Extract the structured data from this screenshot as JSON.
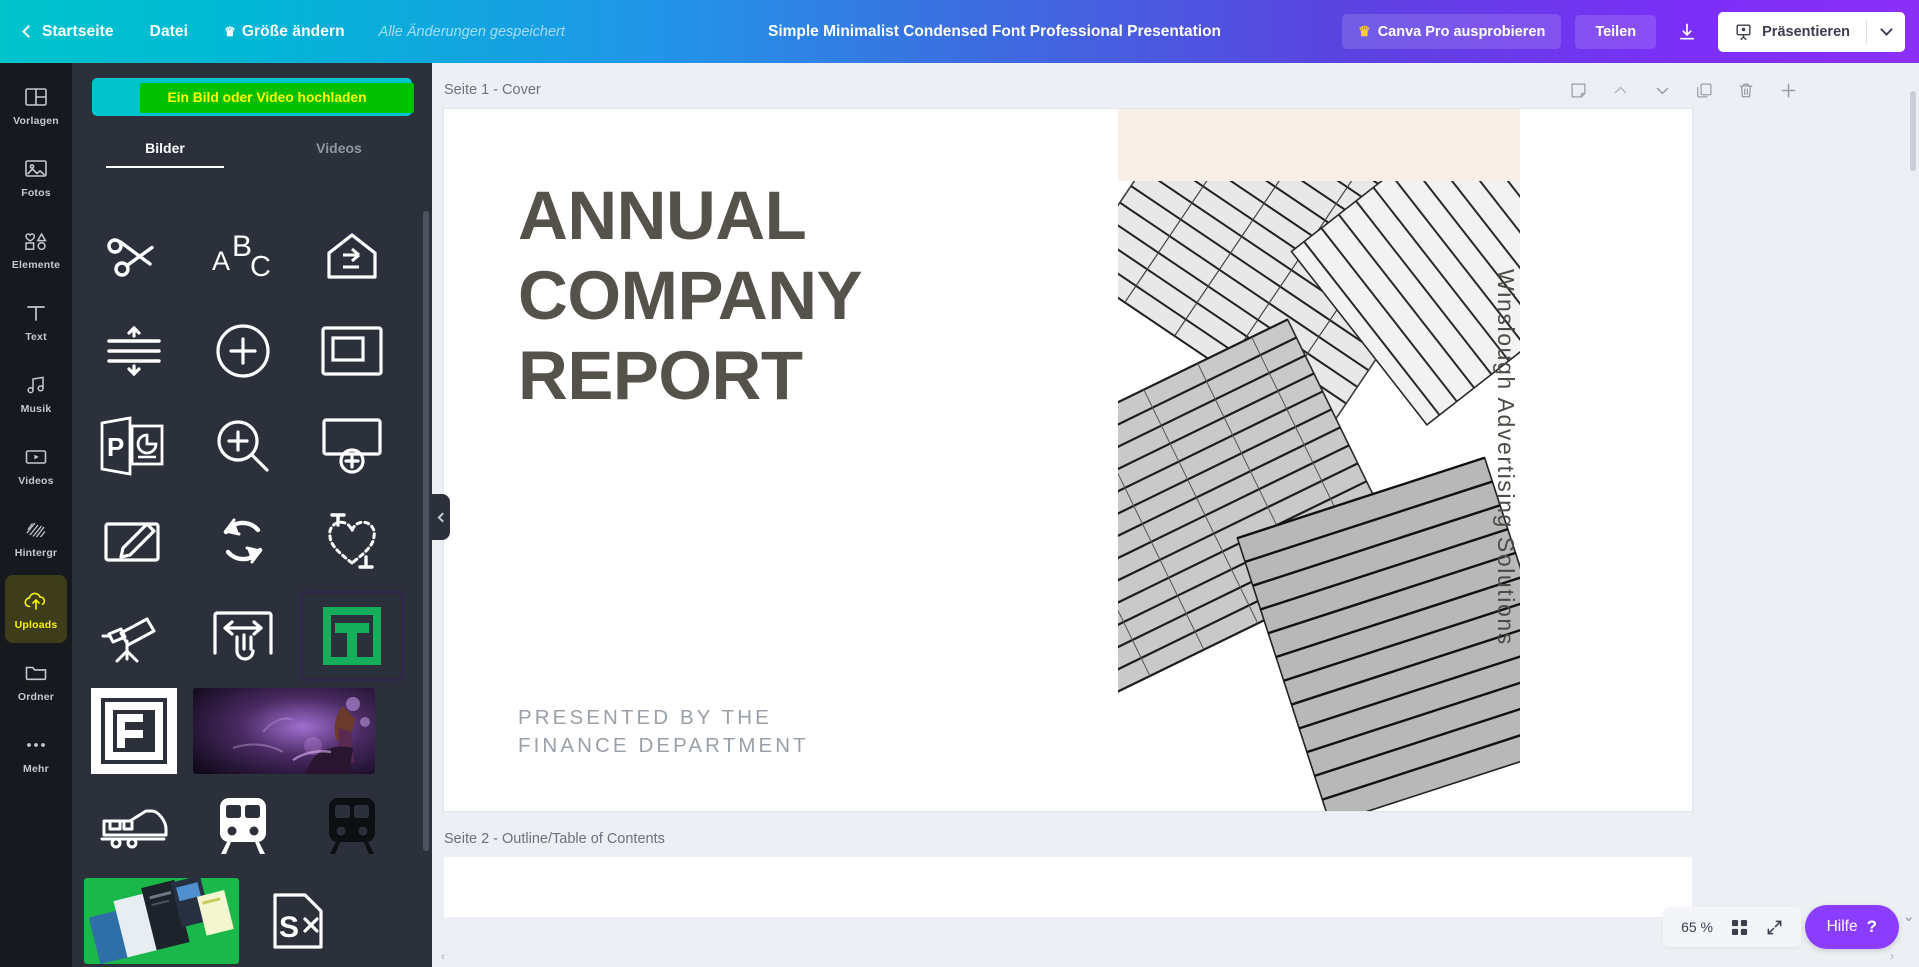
{
  "topbar": {
    "home_label": "Startseite",
    "file_label": "Datei",
    "resize_label": "Größe ändern",
    "saved_status": "Alle Änderungen gespeichert",
    "doc_title": "Simple Minimalist Condensed Font Professional Presentation",
    "pro_label": "Canva Pro ausprobieren",
    "share_label": "Teilen",
    "present_label": "Präsentieren",
    "accent_gradient_start": "#00c4cc",
    "accent_gradient_end": "#8b2ff7"
  },
  "rail": {
    "items": [
      {
        "label": "Vorlagen",
        "icon": "templates-icon",
        "active": false
      },
      {
        "label": "Fotos",
        "icon": "photos-icon",
        "active": false
      },
      {
        "label": "Elemente",
        "icon": "elements-icon",
        "active": false
      },
      {
        "label": "Text",
        "icon": "text-icon",
        "active": false
      },
      {
        "label": "Musik",
        "icon": "music-icon",
        "active": false
      },
      {
        "label": "Videos",
        "icon": "videos-icon",
        "active": false
      },
      {
        "label": "Hintergr",
        "icon": "background-icon",
        "active": false
      },
      {
        "label": "Uploads",
        "icon": "upload-cloud-icon",
        "active": true
      },
      {
        "label": "Ordner",
        "icon": "folder-icon",
        "active": false
      },
      {
        "label": "Mehr",
        "icon": "more-dots-icon",
        "active": false
      }
    ],
    "active_color": "#f5f500"
  },
  "panel": {
    "upload_button_label": "Ein Bild oder Video hochladen",
    "upload_button_bg": "#00c4cc",
    "upload_highlight_bg": "#00c000",
    "upload_text_color": "#ffff00",
    "tabs": [
      {
        "label": "Bilder",
        "active": true
      },
      {
        "label": "Videos",
        "active": false
      }
    ],
    "thumbnails": [
      {
        "name": "scissors-icon",
        "kind": "icon"
      },
      {
        "name": "abc-letters-icon",
        "kind": "icon"
      },
      {
        "name": "house-arrow-icon",
        "kind": "icon"
      },
      {
        "name": "line-spacing-icon",
        "kind": "icon"
      },
      {
        "name": "plus-circle-icon",
        "kind": "icon"
      },
      {
        "name": "window-frame-icon",
        "kind": "icon"
      },
      {
        "name": "powerpoint-icon",
        "kind": "icon"
      },
      {
        "name": "zoom-in-icon",
        "kind": "icon"
      },
      {
        "name": "add-frame-icon",
        "kind": "icon"
      },
      {
        "name": "edit-note-icon",
        "kind": "icon"
      },
      {
        "name": "refresh-cycle-icon",
        "kind": "icon"
      },
      {
        "name": "dashed-heart-icon",
        "kind": "icon"
      },
      {
        "name": "telescope-icon",
        "kind": "icon"
      },
      {
        "name": "drag-resize-icon",
        "kind": "icon"
      },
      {
        "name": "green-m-logo",
        "kind": "logo",
        "selected": true
      },
      {
        "name": "white-e-logo",
        "kind": "logo"
      },
      {
        "name": "guitarist-photo",
        "kind": "photo"
      },
      {
        "name": "train-side-icon",
        "kind": "icon"
      },
      {
        "name": "tram-front-icon",
        "kind": "icon"
      },
      {
        "name": "tram-front-dark-icon",
        "kind": "icon"
      },
      {
        "name": "brochure-green-photo",
        "kind": "photo"
      },
      {
        "name": "document-image-icon",
        "kind": "icon"
      }
    ]
  },
  "canvas": {
    "page1_label": "Seite 1 - Cover",
    "page2_label": "Seite 2 - Outline/Table of Contents",
    "page_tools": [
      "sticky-note-icon",
      "move-up-icon",
      "move-down-icon",
      "duplicate-page-icon",
      "delete-page-icon",
      "add-page-icon"
    ],
    "slide": {
      "title_lines": [
        "ANNUAL",
        "COMPANY",
        "REPORT"
      ],
      "title_color": "#55514b",
      "subtitle_lines": [
        "PRESENTED BY THE",
        "FINANCE DEPARTMENT"
      ],
      "subtitle_color": "#9aa0a8",
      "vertical_text": "Winslough Advertising Solutions",
      "accent_band_color": "#f7efe8"
    }
  },
  "footer": {
    "zoom_level": "65 %",
    "grid_view_icon": "grid-view-icon",
    "fullscreen_icon": "fullscreen-icon",
    "help_label": "Hilfe",
    "help_mark": "?",
    "help_color": "#8b3dff"
  }
}
